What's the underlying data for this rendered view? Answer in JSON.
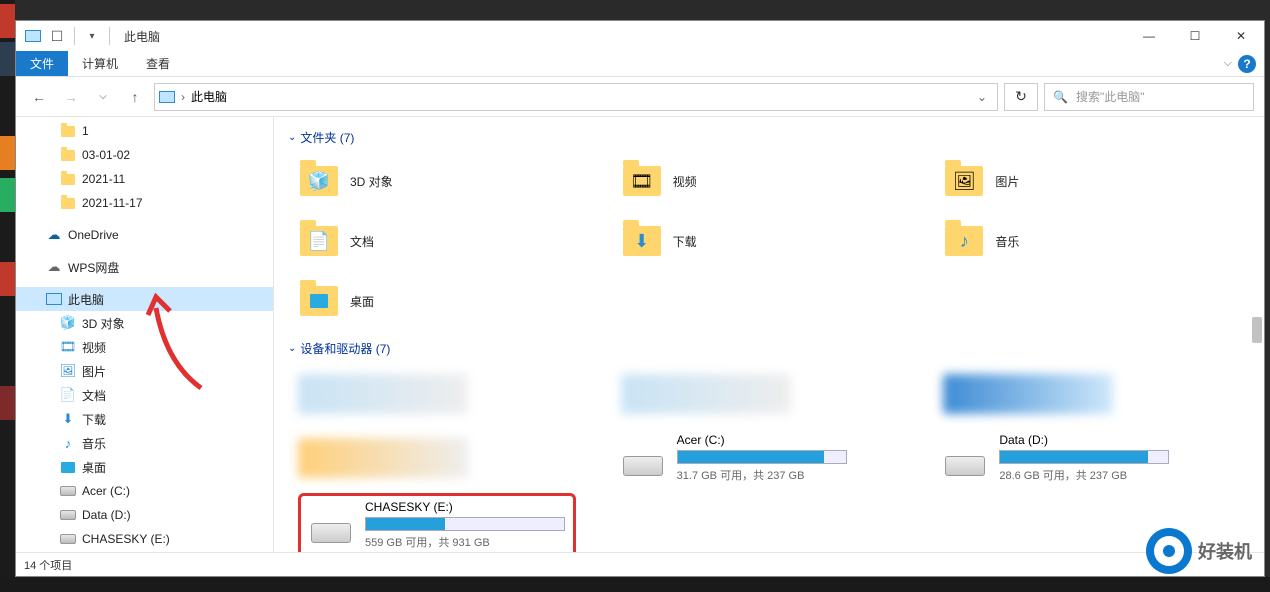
{
  "titlebar": {
    "title": "此电脑"
  },
  "ribbon": {
    "file": "文件",
    "computer": "计算机",
    "view": "查看"
  },
  "nav": {
    "location": "此电脑",
    "search_placeholder": "搜索\"此电脑\""
  },
  "sidebar": {
    "quick": [
      "1",
      "03-01-02",
      "2021-11",
      "2021-11-17"
    ],
    "onedrive": "OneDrive",
    "wps": "WPS网盘",
    "thispc": "此电脑",
    "pc_children": [
      "3D 对象",
      "视频",
      "图片",
      "文档",
      "下载",
      "音乐",
      "桌面",
      "Acer (C:)",
      "Data (D:)",
      "CHASESKY (E:)"
    ]
  },
  "content": {
    "section_folders_label": "文件夹 (7)",
    "folders": [
      "3D 对象",
      "视频",
      "图片",
      "文档",
      "下载",
      "音乐",
      "桌面"
    ],
    "section_drives_label": "设备和驱动器 (7)",
    "drives": {
      "c": {
        "name": "Acer (C:)",
        "sub": "31.7 GB 可用，共 237 GB",
        "fill_pct": 87
      },
      "d": {
        "name": "Data (D:)",
        "sub": "28.6 GB 可用，共 237 GB",
        "fill_pct": 88
      },
      "e": {
        "name": "CHASESKY (E:)",
        "sub": "559 GB 可用，共 931 GB",
        "fill_pct": 40
      }
    }
  },
  "statusbar": {
    "text": "14 个项目"
  },
  "watermark": "好装机"
}
